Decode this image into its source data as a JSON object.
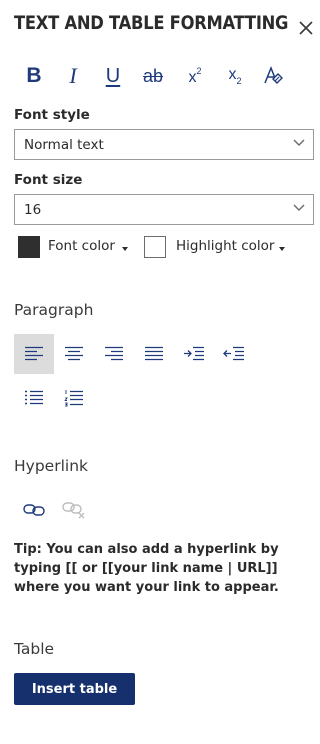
{
  "header": {
    "title": "TEXT AND TABLE FORMATTING",
    "close_icon": "close-icon"
  },
  "formatting": {
    "bold": "B",
    "italic": "I",
    "underline": "U",
    "strikethrough": "ab",
    "superscript_base": "x",
    "superscript_mark": "2",
    "subscript_base": "x",
    "subscript_mark": "2",
    "clear_icon": "clear-formatting-icon"
  },
  "font_style": {
    "label": "Font style",
    "value": "Normal text"
  },
  "font_size": {
    "label": "Font size",
    "value": "16"
  },
  "colors": {
    "font_color_label": "Font color",
    "font_color_value": "#2f2f2f",
    "highlight_color_label": "Highlight color",
    "highlight_color_value": "#ffffff"
  },
  "paragraph": {
    "label": "Paragraph",
    "buttons": [
      "align-left-icon",
      "align-center-icon",
      "align-right-icon",
      "align-justify-icon",
      "indent-icon",
      "outdent-icon",
      "bullet-list-icon",
      "numbered-list-icon"
    ],
    "active": "align-left-icon"
  },
  "hyperlink": {
    "label": "Hyperlink",
    "buttons": [
      "link-icon",
      "unlink-icon"
    ],
    "tip": "Tip: You can also add a hyperlink by typing [[ or [[your link name | URL]] where you want your link to appear."
  },
  "table": {
    "label": "Table",
    "insert_label": "Insert table"
  },
  "theme": {
    "accent": "#16306e",
    "icon_blue": "#1e3a7a",
    "active_bg": "#dcdcdc"
  }
}
